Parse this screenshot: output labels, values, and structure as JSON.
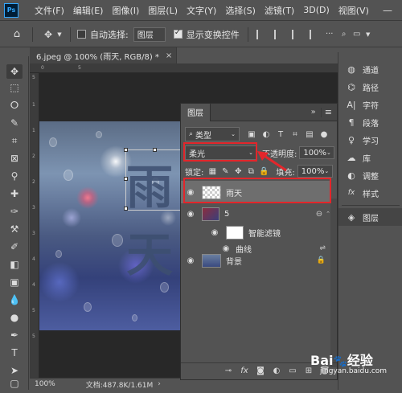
{
  "app": {
    "logo": "Ps",
    "menu": [
      "文件(F)",
      "编辑(E)",
      "图像(I)",
      "图层(L)",
      "文字(Y)",
      "选择(S)",
      "滤镜(T)",
      "3D(D)",
      "视图(V)"
    ]
  },
  "options_bar": {
    "auto_select_label": "自动选择:",
    "auto_select_target": "图层",
    "show_transform_label": "显示变换控件"
  },
  "document": {
    "tab_title": "6.jpeg @ 100% (雨天, RGB/8) *",
    "zoom": "100%",
    "doc_info": "文档:487.8K/1.61M",
    "canvas_text": "雨天",
    "ruler_top": [
      "0",
      "5"
    ],
    "ruler_left": [
      "5",
      "1",
      "1",
      "2",
      "2",
      "3",
      "3",
      "4",
      "4",
      "5",
      "5"
    ]
  },
  "layers_panel": {
    "title": "图层",
    "filter_label": "类型",
    "blend_mode": "柔光",
    "opacity_label": "不透明度:",
    "opacity_value": "100%",
    "lock_label": "锁定:",
    "fill_label": "填充:",
    "fill_value": "100%",
    "layers": [
      {
        "name": "雨天",
        "selected": true
      },
      {
        "name": "5",
        "selected": false
      },
      {
        "name": "智能滤镜",
        "selected": false
      },
      {
        "name": "曲线",
        "selected": false
      },
      {
        "name": "背景",
        "selected": false
      }
    ]
  },
  "right_panel": {
    "items": [
      "通道",
      "路径",
      "字符",
      "段落",
      "学习",
      "库",
      "调整",
      "样式",
      "图层"
    ]
  },
  "colors": {
    "annotation_red": "#e3262b",
    "panel_bg": "#535353",
    "selected_layer_bg": "#6e6e6e"
  },
  "watermark": {
    "brand": "Bai",
    "brand_suffix": "经验",
    "url": "jingyan.baidu.com"
  }
}
